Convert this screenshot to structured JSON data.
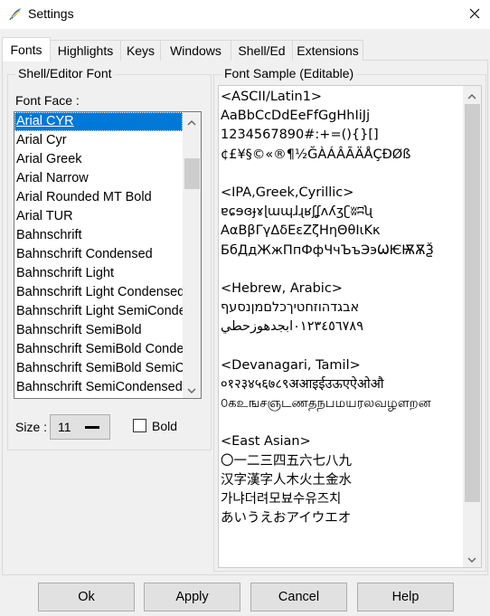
{
  "window": {
    "title": "Settings"
  },
  "tabs": [
    {
      "label": "Fonts",
      "active": true
    },
    {
      "label": "Highlights",
      "active": false
    },
    {
      "label": "Keys",
      "active": false
    },
    {
      "label": "Windows",
      "active": false
    },
    {
      "label": "Shell/Ed",
      "active": false
    },
    {
      "label": "Extensions",
      "active": false
    }
  ],
  "font_group": {
    "title": "Shell/Editor Font",
    "font_face_label": "Font Face :",
    "font_list": [
      "Arial CYR",
      "Arial Cyr",
      "Arial Greek",
      "Arial Narrow",
      "Arial Rounded MT Bold",
      "Arial TUR",
      "Bahnschrift",
      "Bahnschrift Condensed",
      "Bahnschrift Light",
      "Bahnschrift Light Condensed",
      "Bahnschrift Light SemiCondensed",
      "Bahnschrift SemiBold",
      "Bahnschrift SemiBold Condensed",
      "Bahnschrift SemiBold SemiCondensed",
      "Bahnschrift SemiCondensed"
    ],
    "selected_font": "Arial CYR",
    "size_label": "Size :",
    "size_value": "11",
    "bold_label": "Bold",
    "bold_checked": false
  },
  "sample_group": {
    "title": "Font Sample (Editable)",
    "lines": [
      "<ASCII/Latin1>",
      "AaBbCcDdEeFfGgHhIiJj",
      "1234567890#:+=(){}[]",
      "¢£¥§©«®¶½ĞÀÁÂÃÄÅÇÐØß",
      "",
      "<IPA,Greek,Cyrillic>",
      "ɐɕɘɞɟɤɭɯɰɺɻʁʃʆʌʎʒʗʬʭʯ",
      "ΑαΒβΓγΔδΕεΖζΗηΘθΙιΚκ",
      "БбДдЖжПпФфЧчЪъЭэѠѤѬѪѮ",
      "",
      "<Hebrew, Arabic>",
      "אבגדהוזחטיךכלםמןנסעף",
      "٠١٢٣٤٥٦٧٨٩ابجدهوزحطي",
      "",
      "<Devanagari, Tamil>",
      "०१२३४५६७८९अआइईउऊएऐओऔ",
      "௦கஉஙசஞடணதநபமயரலவழளறன",
      "",
      "<East Asian>",
      "〇一二三四五六七八九",
      "汉字漢字人木火土金水",
      "가냐더려모뵤수유즈치",
      "あいうえおアイウエオ"
    ]
  },
  "buttons": {
    "ok": "Ok",
    "apply": "Apply",
    "cancel": "Cancel",
    "help": "Help"
  },
  "icons": {
    "app": "python-feather-icon",
    "close": "close-icon"
  },
  "colors": {
    "selection": "#0078d7",
    "button_face": "#e1e1e1",
    "window_bg": "#f0f0f0"
  }
}
